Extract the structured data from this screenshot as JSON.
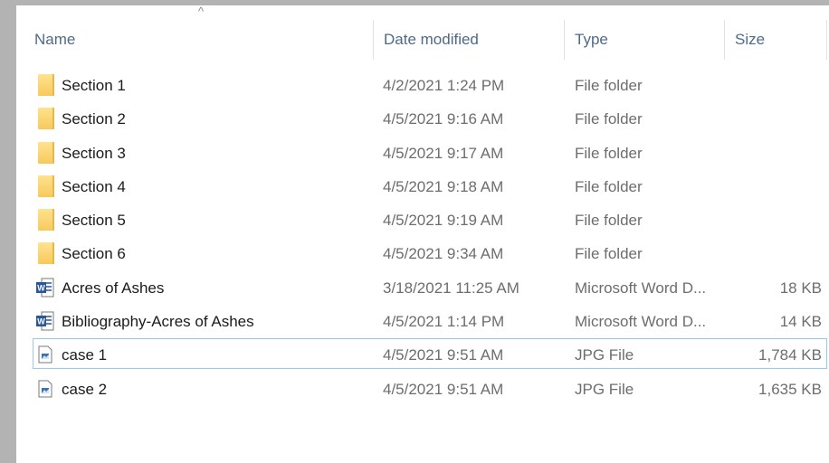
{
  "header": {
    "sort_glyph": "^",
    "name": "Name",
    "date_modified": "Date modified",
    "type": "Type",
    "size": "Size"
  },
  "files": [
    {
      "name": "Section 1",
      "date": "4/2/2021 1:24 PM",
      "type": "File folder",
      "size": "",
      "icon": "folder-icon"
    },
    {
      "name": "Section 2",
      "date": "4/5/2021 9:16 AM",
      "type": "File folder",
      "size": "",
      "icon": "folder-icon"
    },
    {
      "name": "Section 3",
      "date": "4/5/2021 9:17 AM",
      "type": "File folder",
      "size": "",
      "icon": "folder-icon"
    },
    {
      "name": "Section 4",
      "date": "4/5/2021 9:18 AM",
      "type": "File folder",
      "size": "",
      "icon": "folder-icon"
    },
    {
      "name": "Section 5",
      "date": "4/5/2021 9:19 AM",
      "type": "File folder",
      "size": "",
      "icon": "folder-icon"
    },
    {
      "name": "Section 6",
      "date": "4/5/2021 9:34 AM",
      "type": "File folder",
      "size": "",
      "icon": "folder-icon"
    },
    {
      "name": "Acres of Ashes",
      "date": "3/18/2021 11:25 AM",
      "type": "Microsoft Word D...",
      "size": "18 KB",
      "icon": "word-document-icon"
    },
    {
      "name": "Bibliography-Acres of Ashes",
      "date": "4/5/2021 1:14 PM",
      "type": "Microsoft Word D...",
      "size": "14 KB",
      "icon": "word-document-icon"
    },
    {
      "name": "case 1",
      "date": "4/5/2021 9:51 AM",
      "type": "JPG File",
      "size": "1,784 KB",
      "icon": "jpg-image-icon",
      "selected": true
    },
    {
      "name": "case 2",
      "date": "4/5/2021 9:51 AM",
      "type": "JPG File",
      "size": "1,635 KB",
      "icon": "jpg-image-icon"
    }
  ],
  "colors": {
    "header_text": "#4d6a8a",
    "folder": "#f7c95b",
    "word_blue": "#2b579a",
    "selection_border": "#99c9ef",
    "background_frame": "#b3b3b3"
  }
}
